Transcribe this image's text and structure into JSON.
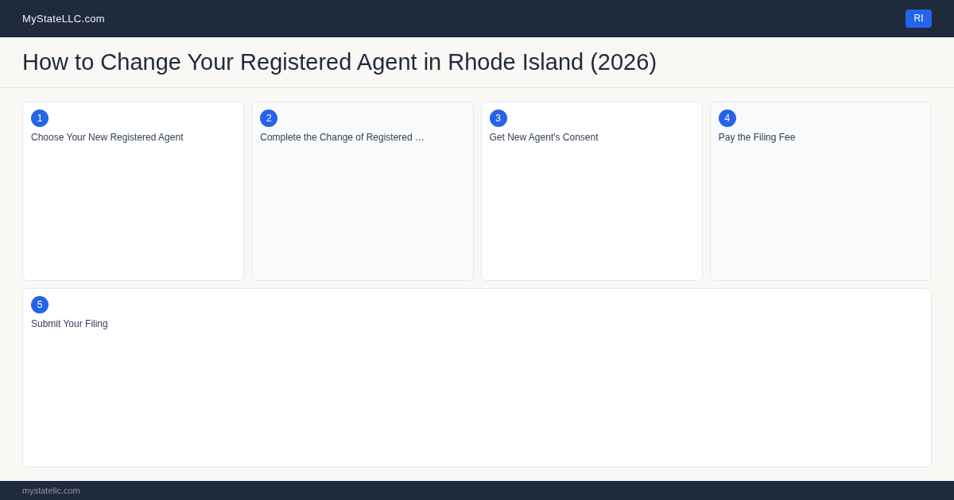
{
  "header": {
    "site_name": "MyStateLLC.com",
    "state_button": "RI"
  },
  "page_title": "How to Change Your Registered Agent in Rhode Island (2026)",
  "steps": [
    {
      "number": "1",
      "title": "Choose Your New Registered Agent"
    },
    {
      "number": "2",
      "title": "Complete the Change of Registered …"
    },
    {
      "number": "3",
      "title": "Get New Agent's Consent"
    },
    {
      "number": "4",
      "title": "Pay the Filing Fee"
    },
    {
      "number": "5",
      "title": "Submit Your Filing"
    }
  ],
  "footer": {
    "text": "mystatellc.com"
  }
}
